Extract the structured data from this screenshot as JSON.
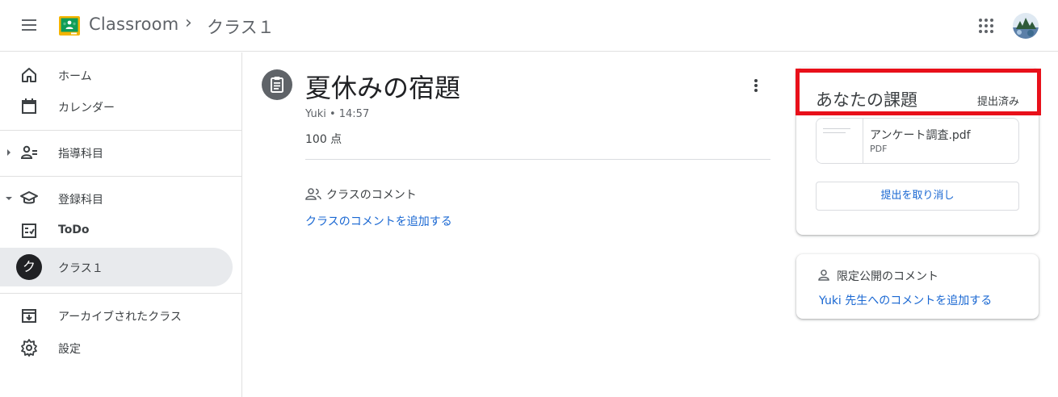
{
  "header": {
    "app_title": "Classroom",
    "breadcrumb_separator": "›",
    "breadcrumb_class": "クラス１"
  },
  "sidebar": {
    "items": [
      {
        "label": "ホーム",
        "icon": "home-icon"
      },
      {
        "label": "カレンダー",
        "icon": "calendar-icon"
      },
      {
        "label": "指導科目",
        "icon": "teaching-icon"
      },
      {
        "label": "登録科目",
        "icon": "enrolled-icon"
      },
      {
        "label": "ToDo",
        "icon": "todo-icon"
      },
      {
        "label": "クラス１",
        "icon": "class-avatar",
        "avatar_letter": "ク",
        "active": true
      },
      {
        "label": "アーカイブされたクラス",
        "icon": "archive-icon"
      },
      {
        "label": "設定",
        "icon": "gear-icon"
      }
    ]
  },
  "assignment": {
    "title": "夏休みの宿題",
    "meta": "Yuki • 14:57",
    "points": "100 点"
  },
  "class_comments": {
    "title": "クラスのコメント",
    "add_link": "クラスのコメントを追加する"
  },
  "your_work": {
    "title": "あなたの課題",
    "status": "提出済み",
    "attachment": {
      "name": "アンケート調査.pdf",
      "type": "PDF"
    },
    "unsubmit_label": "提出を取り消し"
  },
  "private_comments": {
    "title": "限定公開のコメント",
    "add_link": "Yuki 先生へのコメントを追加する"
  },
  "colors": {
    "accent": "#1967d2",
    "highlight": "#e8101a",
    "active_nav": "#e8eaed",
    "logo_green": "#0f9d58",
    "logo_yellow": "#f4b400"
  }
}
